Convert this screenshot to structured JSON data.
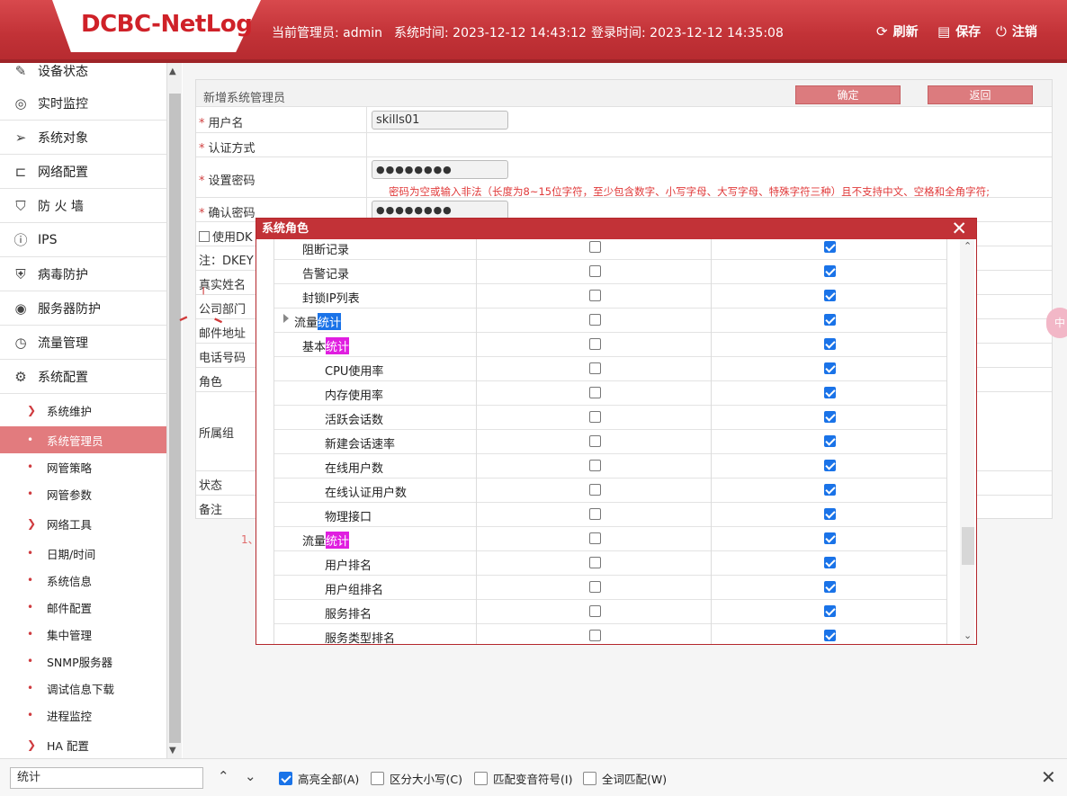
{
  "header": {
    "logo": "DCBC-NetLog",
    "admin": "当前管理员: admin",
    "sys_time": "系统时间: 2023-12-12 14:43:12",
    "login_time": "登录时间: 2023-12-12 14:35:08",
    "refresh": "刷新",
    "save": "保存",
    "logout": "注销"
  },
  "sidebar": {
    "items": [
      {
        "label": "设备状态",
        "icon": "edit-icon"
      },
      {
        "label": "实时监控",
        "icon": "location-icon"
      },
      {
        "label": "系统对象",
        "icon": "send-icon"
      },
      {
        "label": "网络配置",
        "icon": "network-icon"
      },
      {
        "label": "防 火 墙",
        "icon": "shield-icon"
      },
      {
        "label": "IPS",
        "icon": "info-icon"
      },
      {
        "label": "病毒防护",
        "icon": "shield-check-icon"
      },
      {
        "label": "服务器防护",
        "icon": "target-icon"
      },
      {
        "label": "流量管理",
        "icon": "clock-icon"
      },
      {
        "label": "系统配置",
        "icon": "gear-icon"
      }
    ],
    "subitems": [
      {
        "label": "系统维护",
        "marker": "chevron"
      },
      {
        "label": "系统管理员",
        "marker": "dot",
        "active": true
      },
      {
        "label": "网管策略",
        "marker": "dot"
      },
      {
        "label": "网管参数",
        "marker": "dot"
      },
      {
        "label": "网络工具",
        "marker": "chevron"
      },
      {
        "label": "日期/时间",
        "marker": "dot"
      },
      {
        "label": "系统信息",
        "marker": "dot"
      },
      {
        "label": "邮件配置",
        "marker": "dot"
      },
      {
        "label": "集中管理",
        "marker": "dot"
      },
      {
        "label": "SNMP服务器",
        "marker": "dot"
      },
      {
        "label": "调试信息下载",
        "marker": "dot"
      },
      {
        "label": "进程监控",
        "marker": "dot"
      },
      {
        "label": "HA 配置",
        "marker": "chevron"
      }
    ]
  },
  "form": {
    "title": "新增系统管理员",
    "confirm": "确定",
    "back": "返回",
    "username_label": "用户名",
    "username_value": "skills01",
    "auth_label": "认证方式",
    "password_label": "设置密码",
    "password_value": "●●●●●●●●",
    "password_warning": "密码为空或输入非法（长度为8~15位字符，至少包含数字、小写字母、大写字母、特殊字符三种）且不支持中文、空格和全角字符;",
    "confirm_label": "确认密码",
    "confirm_value": "●●●●●●●●",
    "dkey_label": "使用DK",
    "note_label": "注：DKEY",
    "realname_label": "真实姓名",
    "dept_label": "公司部门",
    "email_label": "邮件地址",
    "phone_label": "电话号码",
    "role_label": "角色",
    "group_label": "所属组",
    "status_label": "状态",
    "remark_label": "备注",
    "note_line": "1、"
  },
  "dialog": {
    "title": "系统角色",
    "rows": [
      {
        "label": "阻断记录",
        "indent": 1,
        "read": false,
        "write": true
      },
      {
        "label": "告警记录",
        "indent": 1,
        "read": false,
        "write": true
      },
      {
        "label": "封锁IP列表",
        "indent": 1,
        "read": false,
        "write": true
      },
      {
        "label": "流量",
        "hl": "统计",
        "hl_color": "blue",
        "indent": 0,
        "tree": true,
        "read": false,
        "write": true
      },
      {
        "label": "基本",
        "hl": "统计",
        "hl_color": "pink",
        "indent": 1,
        "read": false,
        "write": true
      },
      {
        "label": "CPU使用率",
        "indent": 2,
        "read": false,
        "write": true
      },
      {
        "label": "内存使用率",
        "indent": 2,
        "read": false,
        "write": true
      },
      {
        "label": "活跃会话数",
        "indent": 2,
        "read": false,
        "write": true
      },
      {
        "label": "新建会话速率",
        "indent": 2,
        "read": false,
        "write": true
      },
      {
        "label": "在线用户数",
        "indent": 2,
        "read": false,
        "write": true
      },
      {
        "label": "在线认证用户数",
        "indent": 2,
        "read": false,
        "write": true
      },
      {
        "label": "物理接口",
        "indent": 2,
        "read": false,
        "write": true
      },
      {
        "label": "流量",
        "hl": "统计",
        "hl_color": "pink",
        "indent": 1,
        "read": false,
        "write": true
      },
      {
        "label": "用户排名",
        "indent": 2,
        "read": false,
        "write": true
      },
      {
        "label": "用户组排名",
        "indent": 2,
        "read": false,
        "write": true
      },
      {
        "label": "服务排名",
        "indent": 2,
        "read": false,
        "write": true
      },
      {
        "label": "服务类型排名",
        "indent": 2,
        "read": false,
        "write": true
      }
    ]
  },
  "findbar": {
    "query": "统计",
    "highlight_all": "高亮全部(A)",
    "match_case": "区分大小写(C)",
    "match_diacritics": "匹配变音符号(I)",
    "whole_words": "全词匹配(W)",
    "highlight_all_checked": true
  },
  "ime": "中"
}
